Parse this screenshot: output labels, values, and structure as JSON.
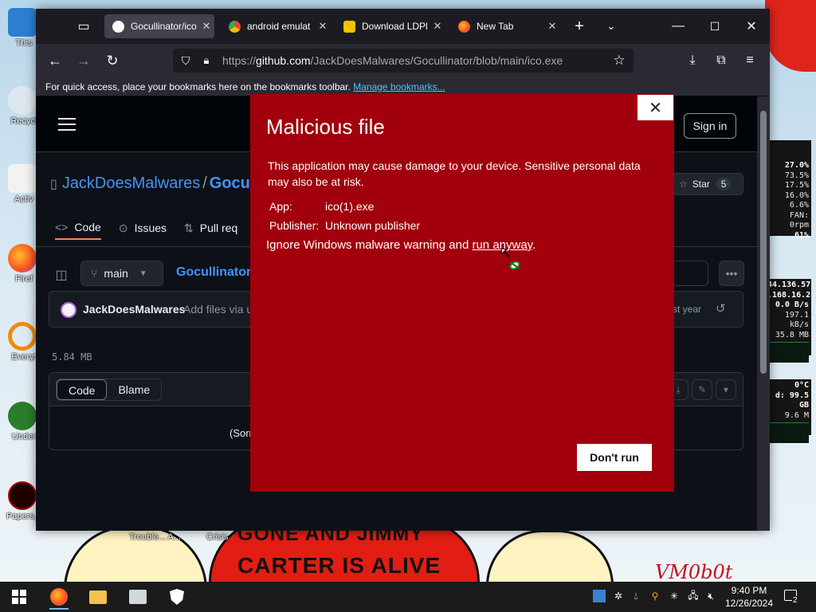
{
  "desktop": {
    "icons": [
      {
        "label": "This"
      },
      {
        "label": "Recycl"
      },
      {
        "label": "Activ"
      },
      {
        "label": "Firef"
      },
      {
        "label": "Everyt"
      },
      {
        "label": "Under"
      },
      {
        "label": "Papers, I"
      }
    ],
    "free_labels": {
      "trouble": "Trouble... A...",
      "crisis": "Crisis"
    },
    "wallpaper_text_1": "GONE AND JIMMY",
    "wallpaper_text_2": "CARTER IS ALIVE",
    "signature": "VM0b0t"
  },
  "system_monitor": {
    "cpu": [
      "27.0%",
      "73.5%",
      "17.5%",
      "16.0%",
      "6.6%",
      "FAN: 0rpm",
      "61%"
    ],
    "network": [
      "44.136.57",
      ".168.16.2",
      "0.0 B/s",
      "197.1 kB/s",
      "35.8 MB"
    ],
    "temps": [
      "0°C",
      "d: 99.5 GB",
      "9.6 M"
    ]
  },
  "browser": {
    "tabs": [
      {
        "title": "Gocullinator/ico",
        "active": true
      },
      {
        "title": "android emulat",
        "active": false
      },
      {
        "title": "Download LDPl",
        "active": false
      },
      {
        "title": "New Tab",
        "active": false
      }
    ],
    "url": {
      "prefix": "https://",
      "host": "github.com",
      "path": "/JackDoesMalwares/Gocullinator/blob/main/ico.exe"
    },
    "bookmarks_text": "For quick access, place your bookmarks here on the bookmarks toolbar.",
    "bookmarks_link": "Manage bookmarks..."
  },
  "github": {
    "signin": "Sign in",
    "owner": "JackDoesMalwares",
    "separator": "/",
    "repo": "Gocu",
    "star_label": "Star",
    "star_count": "5",
    "tabs": [
      "Code",
      "Issues",
      "Pull req"
    ],
    "branch": "main",
    "breadcrumb": "Gocullinator",
    "commit_user": "JackDoesMalwares",
    "commit_msg": "Add files via u",
    "commit_time": "st year",
    "file_size": "5.84 MB",
    "view_code": "Code",
    "view_blame": "Blame",
    "code_body": "(Sorr"
  },
  "dialog": {
    "title": "Malicious file",
    "description": "This application may cause damage to your device. Sensitive personal data may also be at risk.",
    "app_key": "App:",
    "app_value": "ico(1).exe",
    "publisher_key": "Publisher:",
    "publisher_value": "Unknown publisher",
    "ignore_text": "Ignore Windows malware warning and ",
    "ignore_link": "run anyway",
    "ignore_end": ".",
    "dont_run": "Don't run"
  },
  "taskbar": {
    "time": "9:40 PM",
    "date": "12/26/2024",
    "notification_count": "2"
  },
  "colors": {
    "dialog_bg": "#a1000c",
    "github_link": "#4493f8",
    "browser_tab_active": "#42414d"
  }
}
